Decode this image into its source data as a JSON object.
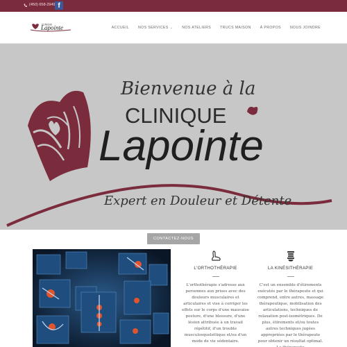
{
  "topbar": {
    "phone": "(450) 658-2949",
    "phone_icon": "phone-icon",
    "social_icon": "facebook-icon",
    "background": "#7b2c3c"
  },
  "header": {
    "logo_text_top": "CLINIQUE",
    "logo_text_main": "Lapointe",
    "nav": [
      {
        "label": "ACCUEIL"
      },
      {
        "label": "NOS SERVICES",
        "has_dropdown": true
      },
      {
        "label": "NOS ATELIERS"
      },
      {
        "label": "TRUCS MAISON"
      },
      {
        "label": "À PROPOS"
      },
      {
        "label": "NOUS JOINDRE"
      }
    ]
  },
  "hero": {
    "welcome": "Bienvenue à la",
    "brand_line1": "CLINIQUE",
    "brand_line2": "Lapointe",
    "tagline": "Expert en Douleur et Détente",
    "accent": "#7b2c3c"
  },
  "cta": {
    "label": "CONTACTEZ-NOUS",
    "color": "#a6a6a6"
  },
  "services": [
    {
      "icon": "foot-icon",
      "title": "L'ORTHOTHÉRAPIE",
      "text": "L'orthothérapie s'adresse aux personnes aux prises avec des douleurs musculaires et articulaires et vise à corriger les effets sur le corps d'une mauvaise posture, d'une blessure, d'une lésion attribuée à un travail répétitif, d'un trouble musculosquelettique et/ou d'un mode de vie sédentaire."
    },
    {
      "icon": "spine-icon",
      "title": "LA KINÉSITHÉRAPIE",
      "text": "C'est un ensemble d'étirements exécutés par le thérapeute et qui comprend, entre autres, massage thérapeutique, mobilisation des articulations, techniques de relaxation post-isométriques. De plus, étirements et/ou toutes autres techniques jugées appropriées par le thérapeute pour obtenir un résultat optimal. Le thérapeute"
    }
  ]
}
